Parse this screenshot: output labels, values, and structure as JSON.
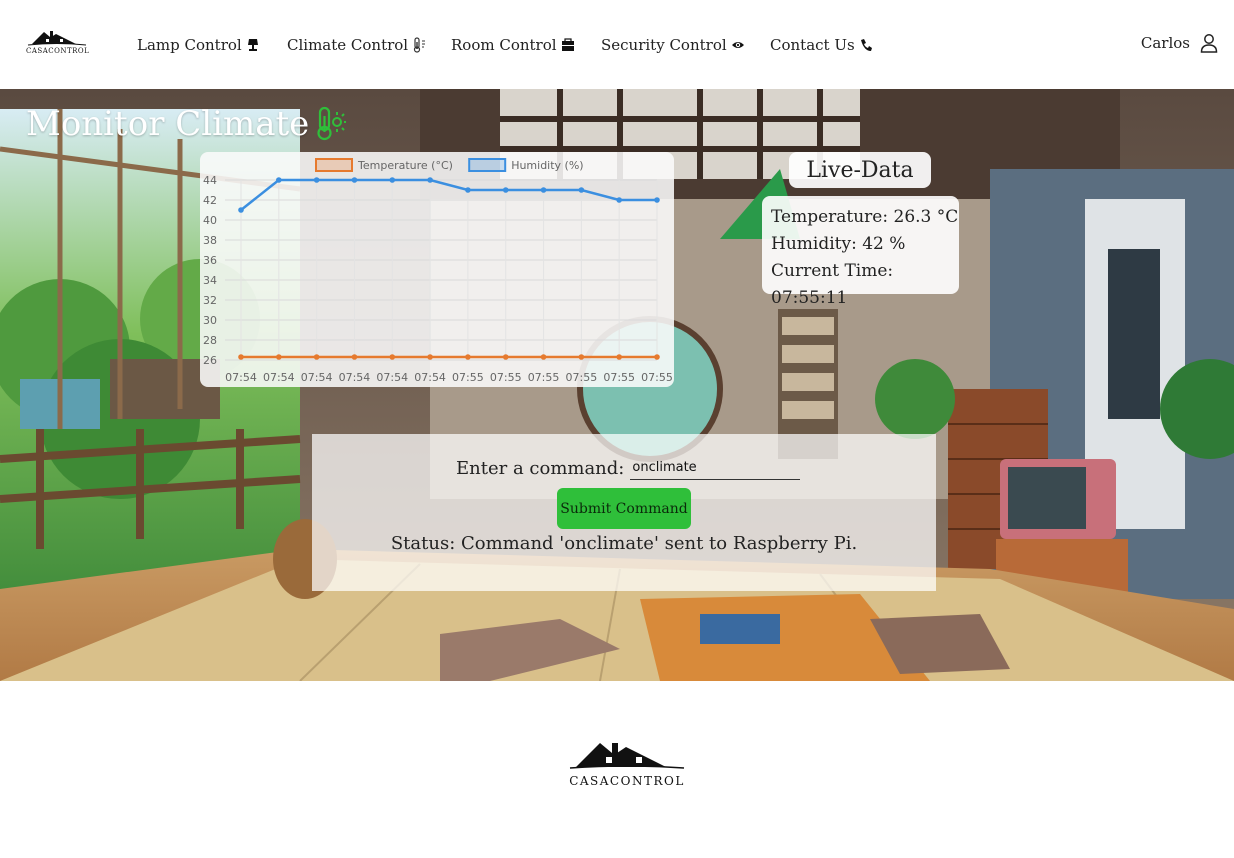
{
  "brand": {
    "name": "CASACONTROL"
  },
  "nav": {
    "items": [
      {
        "label": "Lamp Control",
        "icon": "lamp-icon"
      },
      {
        "label": "Climate Control",
        "icon": "thermometer-icon"
      },
      {
        "label": "Room Control",
        "icon": "room-icon"
      },
      {
        "label": "Security Control",
        "icon": "eye-icon"
      },
      {
        "label": "Contact Us",
        "icon": "phone-icon"
      }
    ]
  },
  "user": {
    "name": "Carlos",
    "icon": "user-icon"
  },
  "page": {
    "title": "Monitor Climate",
    "title_icon": "thermometer-sun-icon"
  },
  "chart_data": {
    "type": "line",
    "categories": [
      "07:54",
      "07:54",
      "07:54",
      "07:54",
      "07:54",
      "07:54",
      "07:55",
      "07:55",
      "07:55",
      "07:55",
      "07:55",
      "07:55"
    ],
    "series": [
      {
        "name": "Temperature (°C)",
        "color": "#e67a2e",
        "values": [
          26.3,
          26.3,
          26.3,
          26.3,
          26.3,
          26.3,
          26.3,
          26.3,
          26.3,
          26.3,
          26.3,
          26.3
        ]
      },
      {
        "name": "Humidity (%)",
        "color": "#3b8fe0",
        "values": [
          41,
          44,
          44,
          44,
          44,
          44,
          43,
          43,
          43,
          43,
          42,
          42
        ]
      }
    ],
    "yticks": [
      26,
      28,
      30,
      32,
      34,
      36,
      38,
      40,
      42,
      44
    ],
    "ylim": [
      26,
      44
    ],
    "legend": "top",
    "grid": true
  },
  "live_data": {
    "title": "Live-Data",
    "temperature": "Temperature: 26.3 °C",
    "humidity": "Humidity: 42 %",
    "time": "Current Time: 07:55:11"
  },
  "command": {
    "label": "Enter a command:",
    "value": "onclimate",
    "submit_label": "Submit Command",
    "status": "Status: Command 'onclimate' sent to Raspberry Pi."
  },
  "colors": {
    "accent": "#2fbf3a",
    "temperature": "#e67a2e",
    "humidity": "#3b8fe0"
  }
}
